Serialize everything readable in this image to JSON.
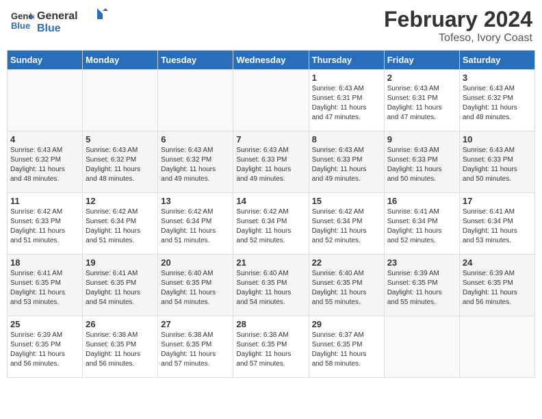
{
  "header": {
    "logo_general": "General",
    "logo_blue": "Blue",
    "main_title": "February 2024",
    "subtitle": "Tofeso, Ivory Coast"
  },
  "columns": [
    "Sunday",
    "Monday",
    "Tuesday",
    "Wednesday",
    "Thursday",
    "Friday",
    "Saturday"
  ],
  "weeks": [
    [
      {
        "day": "",
        "info": ""
      },
      {
        "day": "",
        "info": ""
      },
      {
        "day": "",
        "info": ""
      },
      {
        "day": "",
        "info": ""
      },
      {
        "day": "1",
        "info": "Sunrise: 6:43 AM\nSunset: 6:31 PM\nDaylight: 11 hours\nand 47 minutes."
      },
      {
        "day": "2",
        "info": "Sunrise: 6:43 AM\nSunset: 6:31 PM\nDaylight: 11 hours\nand 47 minutes."
      },
      {
        "day": "3",
        "info": "Sunrise: 6:43 AM\nSunset: 6:32 PM\nDaylight: 11 hours\nand 48 minutes."
      }
    ],
    [
      {
        "day": "4",
        "info": "Sunrise: 6:43 AM\nSunset: 6:32 PM\nDaylight: 11 hours\nand 48 minutes."
      },
      {
        "day": "5",
        "info": "Sunrise: 6:43 AM\nSunset: 6:32 PM\nDaylight: 11 hours\nand 48 minutes."
      },
      {
        "day": "6",
        "info": "Sunrise: 6:43 AM\nSunset: 6:32 PM\nDaylight: 11 hours\nand 49 minutes."
      },
      {
        "day": "7",
        "info": "Sunrise: 6:43 AM\nSunset: 6:33 PM\nDaylight: 11 hours\nand 49 minutes."
      },
      {
        "day": "8",
        "info": "Sunrise: 6:43 AM\nSunset: 6:33 PM\nDaylight: 11 hours\nand 49 minutes."
      },
      {
        "day": "9",
        "info": "Sunrise: 6:43 AM\nSunset: 6:33 PM\nDaylight: 11 hours\nand 50 minutes."
      },
      {
        "day": "10",
        "info": "Sunrise: 6:43 AM\nSunset: 6:33 PM\nDaylight: 11 hours\nand 50 minutes."
      }
    ],
    [
      {
        "day": "11",
        "info": "Sunrise: 6:42 AM\nSunset: 6:33 PM\nDaylight: 11 hours\nand 51 minutes."
      },
      {
        "day": "12",
        "info": "Sunrise: 6:42 AM\nSunset: 6:34 PM\nDaylight: 11 hours\nand 51 minutes."
      },
      {
        "day": "13",
        "info": "Sunrise: 6:42 AM\nSunset: 6:34 PM\nDaylight: 11 hours\nand 51 minutes."
      },
      {
        "day": "14",
        "info": "Sunrise: 6:42 AM\nSunset: 6:34 PM\nDaylight: 11 hours\nand 52 minutes."
      },
      {
        "day": "15",
        "info": "Sunrise: 6:42 AM\nSunset: 6:34 PM\nDaylight: 11 hours\nand 52 minutes."
      },
      {
        "day": "16",
        "info": "Sunrise: 6:41 AM\nSunset: 6:34 PM\nDaylight: 11 hours\nand 52 minutes."
      },
      {
        "day": "17",
        "info": "Sunrise: 6:41 AM\nSunset: 6:34 PM\nDaylight: 11 hours\nand 53 minutes."
      }
    ],
    [
      {
        "day": "18",
        "info": "Sunrise: 6:41 AM\nSunset: 6:35 PM\nDaylight: 11 hours\nand 53 minutes."
      },
      {
        "day": "19",
        "info": "Sunrise: 6:41 AM\nSunset: 6:35 PM\nDaylight: 11 hours\nand 54 minutes."
      },
      {
        "day": "20",
        "info": "Sunrise: 6:40 AM\nSunset: 6:35 PM\nDaylight: 11 hours\nand 54 minutes."
      },
      {
        "day": "21",
        "info": "Sunrise: 6:40 AM\nSunset: 6:35 PM\nDaylight: 11 hours\nand 54 minutes."
      },
      {
        "day": "22",
        "info": "Sunrise: 6:40 AM\nSunset: 6:35 PM\nDaylight: 11 hours\nand 55 minutes."
      },
      {
        "day": "23",
        "info": "Sunrise: 6:39 AM\nSunset: 6:35 PM\nDaylight: 11 hours\nand 55 minutes."
      },
      {
        "day": "24",
        "info": "Sunrise: 6:39 AM\nSunset: 6:35 PM\nDaylight: 11 hours\nand 56 minutes."
      }
    ],
    [
      {
        "day": "25",
        "info": "Sunrise: 6:39 AM\nSunset: 6:35 PM\nDaylight: 11 hours\nand 56 minutes."
      },
      {
        "day": "26",
        "info": "Sunrise: 6:38 AM\nSunset: 6:35 PM\nDaylight: 11 hours\nand 56 minutes."
      },
      {
        "day": "27",
        "info": "Sunrise: 6:38 AM\nSunset: 6:35 PM\nDaylight: 11 hours\nand 57 minutes."
      },
      {
        "day": "28",
        "info": "Sunrise: 6:38 AM\nSunset: 6:35 PM\nDaylight: 11 hours\nand 57 minutes."
      },
      {
        "day": "29",
        "info": "Sunrise: 6:37 AM\nSunset: 6:35 PM\nDaylight: 11 hours\nand 58 minutes."
      },
      {
        "day": "",
        "info": ""
      },
      {
        "day": "",
        "info": ""
      }
    ]
  ]
}
